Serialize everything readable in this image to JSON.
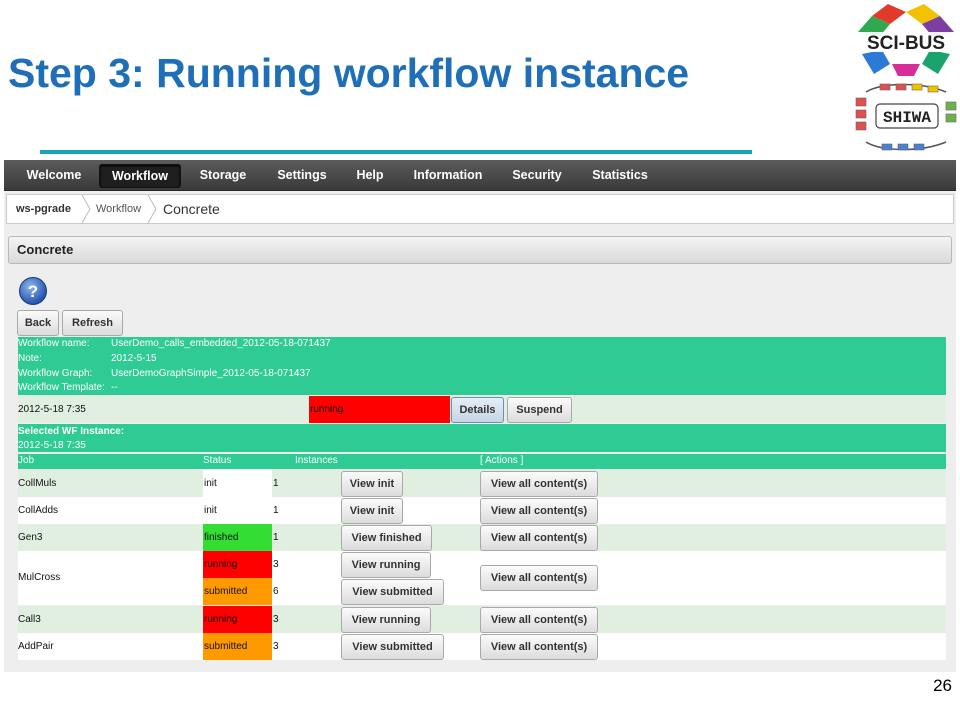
{
  "slide": {
    "title": "Step 3: Running workflow instance",
    "page_number": "26"
  },
  "logos": {
    "scibus_text": "SCI-BUS",
    "shiwa_text": "SHIWA"
  },
  "menu": [
    "Welcome",
    "Workflow",
    "Storage",
    "Settings",
    "Help",
    "Information",
    "Security",
    "Statistics"
  ],
  "menu_active": "Workflow",
  "breadcrumb": [
    "ws-pgrade",
    "Workflow",
    "Concrete"
  ],
  "panel_title": "Concrete",
  "buttons": {
    "back": "Back",
    "refresh": "Refresh",
    "details": "Details",
    "suspend": "Suspend"
  },
  "workflow_info": {
    "name_label": "Workflow name:",
    "name_value": "UserDemo_calls_embedded_2012-05-18-071437",
    "note_label": "Note:",
    "note_value": "2012-5-15",
    "graph_label": "Workflow Graph:",
    "graph_value": "UserDemoGraphSimple_2012-05-18-071437",
    "template_label": "Workflow Template:",
    "template_value": "--"
  },
  "instance": {
    "date": "2012-5-18 7:35",
    "status": "running"
  },
  "selected": {
    "label": "Selected WF Instance:",
    "date": "2012-5-18 7:35"
  },
  "columns": {
    "job": "Job",
    "status": "Status",
    "instances": "Instances",
    "actions": "[ Actions ]"
  },
  "jobs": [
    {
      "name": "CollMuls",
      "statuses": [
        {
          "status": "init",
          "count": "1",
          "view": "View init"
        }
      ],
      "content": "View all content(s)"
    },
    {
      "name": "CollAdds",
      "statuses": [
        {
          "status": "init",
          "count": "1",
          "view": "View init"
        }
      ],
      "content": "View all content(s)"
    },
    {
      "name": "Gen3",
      "statuses": [
        {
          "status": "finished",
          "count": "1",
          "view": "View finished"
        }
      ],
      "content": "View all content(s)"
    },
    {
      "name": "MulCross",
      "statuses": [
        {
          "status": "running",
          "count": "3",
          "view": "View running"
        },
        {
          "status": "submitted",
          "count": "6",
          "view": "View submitted"
        }
      ],
      "content": "View all content(s)"
    },
    {
      "name": "Call3",
      "statuses": [
        {
          "status": "running",
          "count": "3",
          "view": "View running"
        }
      ],
      "content": "View all content(s)"
    },
    {
      "name": "AddPair",
      "statuses": [
        {
          "status": "submitted",
          "count": "3",
          "view": "View submitted"
        }
      ],
      "content": "View all content(s)"
    }
  ],
  "colors": {
    "title": "#1e6eb8",
    "band": "#2ecc94",
    "running": "#ff0000",
    "submitted": "#ff9900",
    "finished": "#33dd33"
  }
}
